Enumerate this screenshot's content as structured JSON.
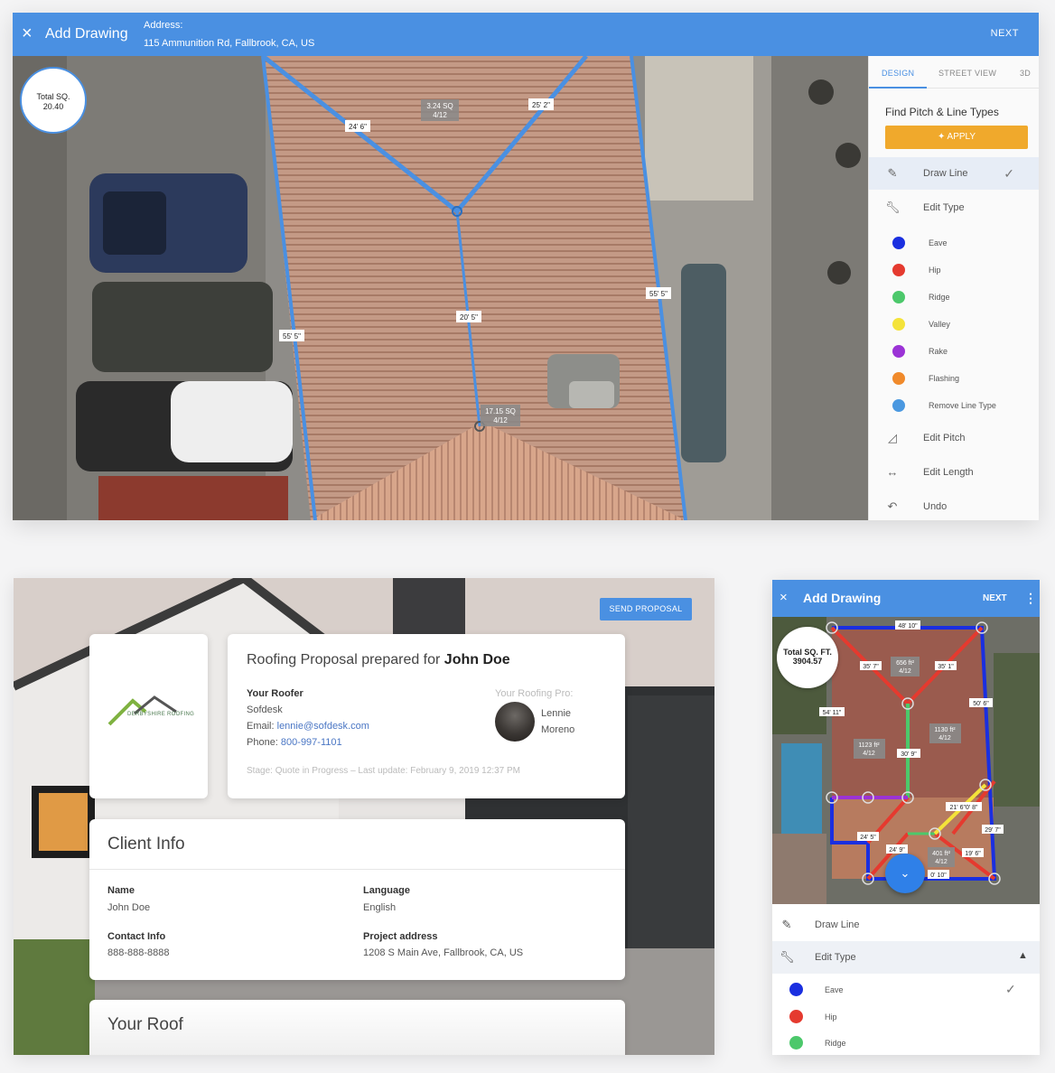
{
  "top": {
    "header": {
      "close_icon": "×",
      "title": "Add Drawing",
      "address_label": "Address:",
      "address": "115 Ammunition Rd, Fallbrook, CA, US",
      "next": "NEXT"
    },
    "total_badge": {
      "label": "Total SQ.",
      "value": "20.40"
    },
    "measurements": {
      "section1_sq": "3.24 SQ",
      "section1_pitch": "4/12",
      "section2_sq": "17.15 SQ",
      "section2_pitch": "4/12",
      "len_24_6": "24' 6\"",
      "len_25_2": "25' 2\"",
      "len_20_5": "20' 5\"",
      "len_55_5_left": "55' 5\"",
      "len_55_5_right": "55' 5\""
    },
    "tabs": [
      "DESIGN",
      "STREET VIEW",
      "3D"
    ],
    "panel_title": "Find Pitch & Line Types",
    "apply_label": "APPLY",
    "tools": {
      "draw_line": "Draw Line",
      "edit_type": "Edit Type",
      "edit_pitch": "Edit Pitch",
      "edit_length": "Edit Length",
      "undo": "Undo"
    },
    "line_types": [
      {
        "label": "Eave",
        "color": "#1a2fe0"
      },
      {
        "label": "Hip",
        "color": "#e53a2f"
      },
      {
        "label": "Ridge",
        "color": "#4cc86b"
      },
      {
        "label": "Valley",
        "color": "#f4e33a"
      },
      {
        "label": "Rake",
        "color": "#9b33d6"
      },
      {
        "label": "Flashing",
        "color": "#f08a2b"
      },
      {
        "label": "Remove Line Type",
        "color": "#4a98e0"
      }
    ]
  },
  "proposal": {
    "send_button": "SEND PROPOSAL",
    "logo_text": "DERBYSHIRE ROOFING",
    "title_prefix": "Roofing Proposal prepared for ",
    "client_name": "John Doe",
    "roofer_label": "Your Roofer",
    "roofer_company": "Sofdesk",
    "email_label": "Email: ",
    "email": "lennie@sofdesk.com",
    "phone_label": "Phone: ",
    "phone": "800-997-1101",
    "pro_label": "Your Roofing Pro:",
    "pro_first": "Lennie",
    "pro_last": "Moreno",
    "stage": "Stage: Quote in Progress – Last update: February 9, 2019 12:37 PM",
    "client_info_title": "Client Info",
    "fields": {
      "name_label": "Name",
      "name_value": "John Doe",
      "language_label": "Language",
      "language_value": "English",
      "contact_label": "Contact Info",
      "contact_value": "888-888-8888",
      "project_label": "Project address",
      "project_value": "1208 S Main Ave, Fallbrook, CA, US"
    },
    "your_roof_title": "Your Roof"
  },
  "mobile": {
    "header": {
      "close_icon": "×",
      "title": "Add Drawing",
      "next": "NEXT",
      "more_icon": "⋮"
    },
    "total_badge": {
      "label": "Total SQ. FT.",
      "value": "3904.57"
    },
    "measurements": {
      "len_48_10": "48' 10\"",
      "len_35_7_left": "35' 7\"",
      "len_35_1": "35' 1\"",
      "area_656": "656 ft²",
      "area_656_pitch": "4/12",
      "len_54_11": "54' 11\"",
      "len_50_6": "50' 6\"",
      "area_1123": "1123 ft²",
      "area_1123_pitch": "4/12",
      "area_1130": "1130 ft²",
      "area_1130_pitch": "4/12",
      "len_30_9": "30' 9\"",
      "len_21_6": "21' 6\"0' 8\"",
      "len_24_5": "24' 5\"",
      "len_29_7": "29' 7\"",
      "len_24_9": "24' 9\"",
      "area_401": "401 ft²",
      "area_401_pitch": "4/12",
      "len_19_6": "19' 6\"",
      "len_0_10": "0' 10\""
    },
    "tools": {
      "draw_line": "Draw Line",
      "edit_type": "Edit Type"
    },
    "line_types": [
      {
        "label": "Eave",
        "color": "#1a2fe0"
      },
      {
        "label": "Hip",
        "color": "#e53a2f"
      },
      {
        "label": "Ridge",
        "color": "#4cc86b"
      }
    ]
  }
}
